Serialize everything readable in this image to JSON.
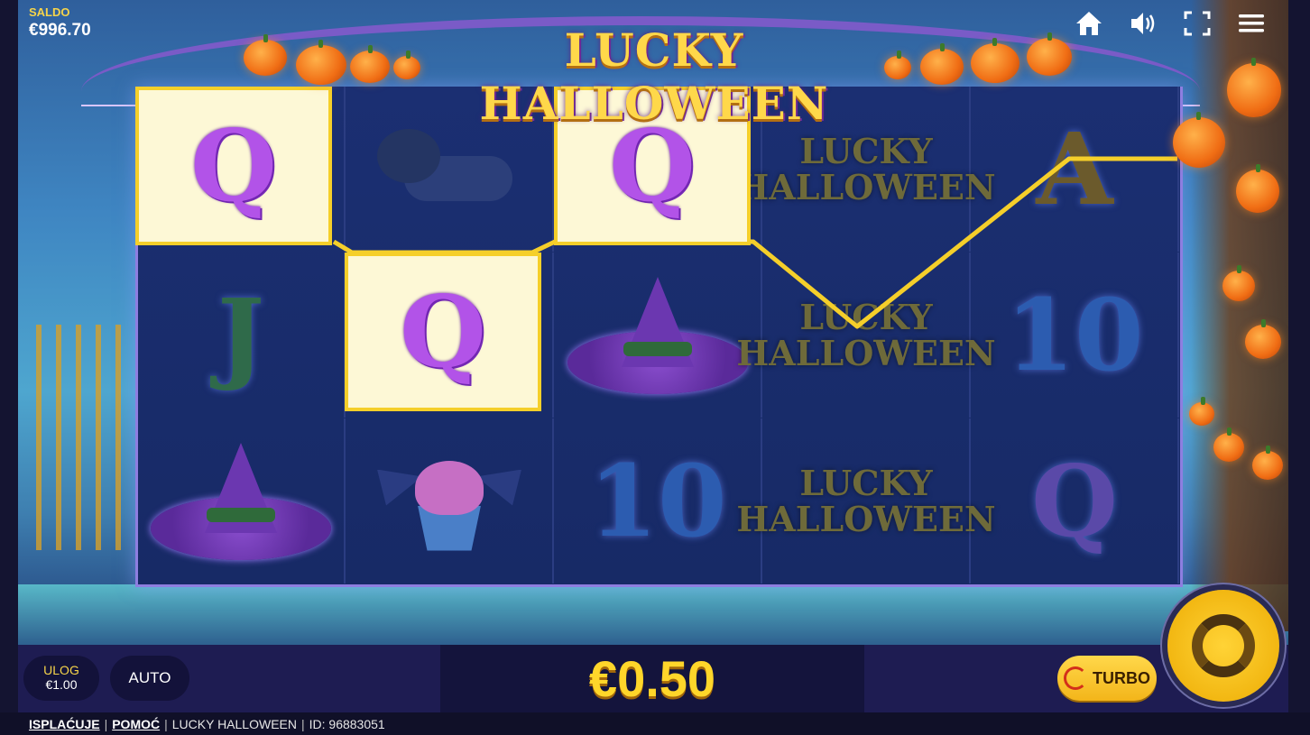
{
  "balance": {
    "label": "SALDO",
    "value": "€996.70"
  },
  "title": "LUCKY HALLOWEEN",
  "top_icons": [
    "home-icon",
    "speaker-icon",
    "fullscreen-icon",
    "menu-icon"
  ],
  "reels": {
    "columns": [
      [
        "Q",
        "J",
        "witch-hat"
      ],
      [
        "mummy-cat",
        "Q",
        "bat-cupcake"
      ],
      [
        "Q",
        "witch-hat",
        "10"
      ],
      [
        "LUCKY HALLOWEEN",
        "LUCKY HALLOWEEN",
        "LUCKY HALLOWEEN"
      ],
      [
        "A",
        "10",
        "Q"
      ]
    ],
    "logo_line1": "LUCKY",
    "logo_line2": "HALLOWEEN",
    "winning_symbols": [
      {
        "reel": 1,
        "row": 1,
        "symbol": "Q"
      },
      {
        "reel": 2,
        "row": 2,
        "symbol": "Q"
      },
      {
        "reel": 3,
        "row": 1,
        "symbol": "Q"
      }
    ]
  },
  "bet": {
    "label": "ULOG",
    "value": "€1.00"
  },
  "auto_label": "AUTO",
  "win_amount": "€0.50",
  "turbo_label": "TURBO",
  "spin_button": "spin-icon",
  "footer": {
    "paytable": "ISPLAĆUJE",
    "help": "POMOĆ",
    "game_name": "LUCKY HALLOWEEN",
    "id": "ID: 96883051"
  },
  "colors": {
    "win_highlight": "#f5cf2a",
    "win_amount": "#ffd62a",
    "q_symbol": "#b253e8"
  }
}
